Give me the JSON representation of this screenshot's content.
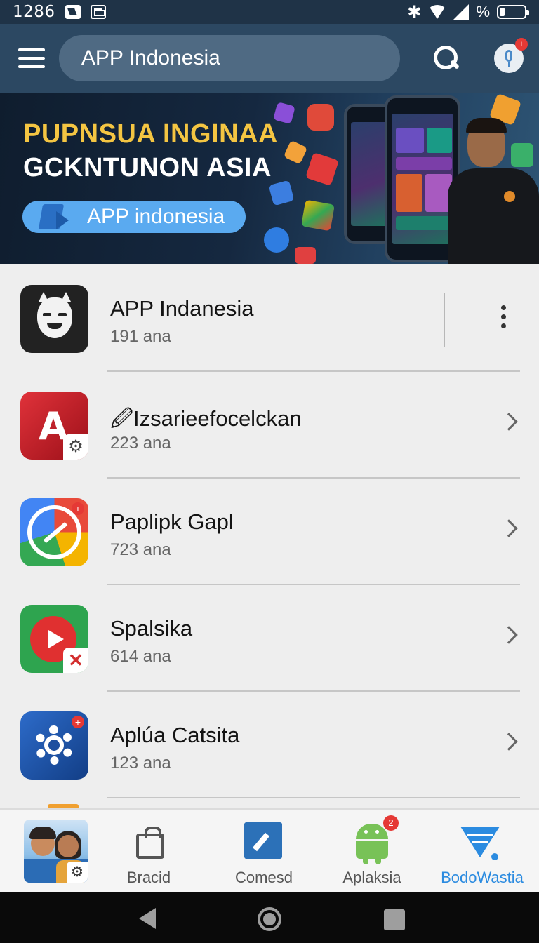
{
  "status_bar": {
    "time": "1286",
    "battery_label": "%",
    "icons": [
      "nfc-icon",
      "save-icon",
      "bluetooth-icon",
      "wifi-icon",
      "signal-icon",
      "battery-icon"
    ]
  },
  "app_bar": {
    "search_text": "APP Indonesia",
    "icons": [
      "menu-icon",
      "search-icon",
      "microphone-icon"
    ],
    "mic_badge": "+"
  },
  "banner": {
    "title": "PUPNSUA INGINAA",
    "subtitle": "GCKNTUNON ASIA",
    "button_label": "APP indonesia",
    "colors": {
      "title": "#f4c542",
      "button": "#5aaaf0"
    }
  },
  "apps": [
    {
      "name": "APP Indanesia",
      "count": "191 ana",
      "icon": "mask-face-icon",
      "action": "more-options"
    },
    {
      "name": "🖉Izsarieefocelckan",
      "count": "223 ana",
      "icon": "red-a-app-icon",
      "action": "chevron"
    },
    {
      "name": "Paplipk Gapl",
      "count": "723 ana",
      "icon": "growth-chart-icon",
      "action": "chevron"
    },
    {
      "name": "Spalsika",
      "count": "614 ana",
      "icon": "play-button-icon",
      "action": "chevron"
    },
    {
      "name": "Aplúa Catsita",
      "count": "123 ana",
      "icon": "gear-search-icon",
      "action": "chevron"
    }
  ],
  "bottom_nav": {
    "items": [
      {
        "label": "",
        "icon": "profile-avatar-icon"
      },
      {
        "label": "Bracid",
        "icon": "shopping-bag-icon"
      },
      {
        "label": "Comesd",
        "icon": "compose-icon"
      },
      {
        "label": "Aplaksia",
        "icon": "android-icon",
        "badge": "2"
      },
      {
        "label": "BodoWastia",
        "icon": "funnel-icon",
        "active": true
      }
    ],
    "active_color": "#2b8be0"
  },
  "system_nav": [
    "back-icon",
    "home-icon",
    "recents-icon"
  ]
}
